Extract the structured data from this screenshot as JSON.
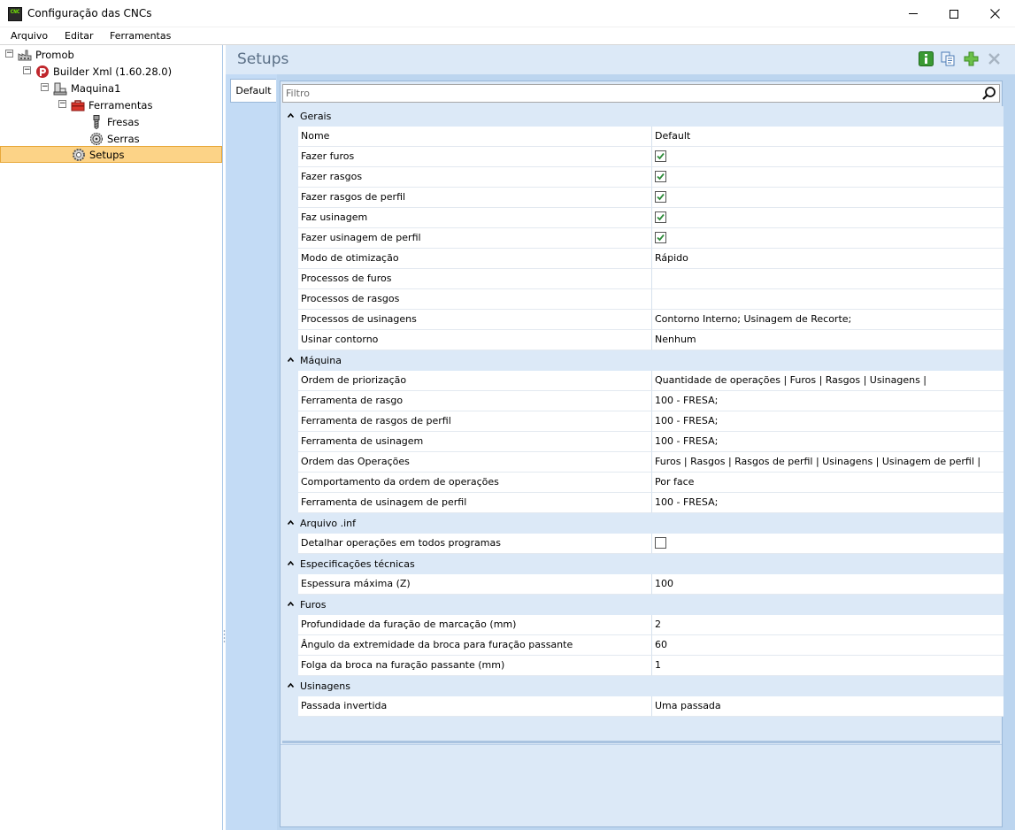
{
  "window": {
    "title": "Configuração das CNCs",
    "app_icon_text": "CNC"
  },
  "menu": [
    "Arquivo",
    "Editar",
    "Ferramentas"
  ],
  "tree": [
    {
      "label": "Promob",
      "icon": "factory-icon",
      "expander": "−"
    },
    {
      "label": "Builder Xml (1.60.28.0)",
      "icon": "builder-logo-icon",
      "expander": "−"
    },
    {
      "label": "Maquina1",
      "icon": "machine-icon",
      "expander": "−"
    },
    {
      "label": "Ferramentas",
      "icon": "toolbox-icon",
      "expander": "−"
    },
    {
      "label": "Fresas",
      "icon": "drill-bit-icon"
    },
    {
      "label": "Serras",
      "icon": "saw-blade-icon"
    },
    {
      "label": "Setups",
      "icon": "gear-icon",
      "selected": true
    }
  ],
  "panel": {
    "title": "Setups",
    "toolbar_icons": [
      "info-icon",
      "copy-icon",
      "add-icon",
      "delete-icon"
    ],
    "tab": "Default",
    "filter_placeholder": "Filtro"
  },
  "grid": [
    {
      "category": "Gerais",
      "rows": [
        {
          "name": "Nome",
          "value": "Default"
        },
        {
          "name": "Fazer furos",
          "check": true
        },
        {
          "name": "Fazer rasgos",
          "check": true
        },
        {
          "name": "Fazer rasgos de perfil",
          "check": true
        },
        {
          "name": "Faz usinagem",
          "check": true
        },
        {
          "name": "Fazer usinagem de perfil",
          "check": true
        },
        {
          "name": "Modo de otimização",
          "value": "Rápido"
        },
        {
          "name": "Processos de furos",
          "value": ""
        },
        {
          "name": "Processos de rasgos",
          "value": ""
        },
        {
          "name": "Processos de usinagens",
          "value": "Contorno Interno; Usinagem de Recorte;"
        },
        {
          "name": "Usinar contorno",
          "value": "Nenhum"
        }
      ]
    },
    {
      "category": "Máquina",
      "rows": [
        {
          "name": "Ordem de priorização",
          "value": "Quantidade de operações | Furos | Rasgos | Usinagens |"
        },
        {
          "name": "Ferramenta de rasgo",
          "value": "100 - FRESA;"
        },
        {
          "name": "Ferramenta de rasgos de perfil",
          "value": "100 - FRESA;"
        },
        {
          "name": "Ferramenta de usinagem",
          "value": "100 - FRESA;"
        },
        {
          "name": "Ordem das Operações",
          "value": "Furos | Rasgos | Rasgos de perfil | Usinagens | Usinagem de perfil |"
        },
        {
          "name": "Comportamento da ordem de operações",
          "value": "Por face"
        },
        {
          "name": "Ferramenta de usinagem de perfil",
          "value": "100 - FRESA;"
        }
      ]
    },
    {
      "category": "Arquivo .inf",
      "rows": [
        {
          "name": "Detalhar operações em todos programas",
          "check": false
        }
      ]
    },
    {
      "category": "Especificações técnicas",
      "rows": [
        {
          "name": "Espessura máxima (Z)",
          "value": "100"
        }
      ]
    },
    {
      "category": "Furos",
      "rows": [
        {
          "name": "Profundidade da furação de marcação (mm)",
          "value": "2"
        },
        {
          "name": "Ângulo da extremidade da broca para furação passante",
          "value": "60"
        },
        {
          "name": "Folga da broca na furação passante (mm)",
          "value": "1"
        }
      ]
    },
    {
      "category": "Usinagens",
      "rows": [
        {
          "name": "Passada invertida",
          "value": "Uma passada"
        }
      ]
    }
  ],
  "colors": {
    "selection": "#fcd387",
    "panel_bg": "#dce9f7",
    "check_green": "#2e8b3a"
  }
}
